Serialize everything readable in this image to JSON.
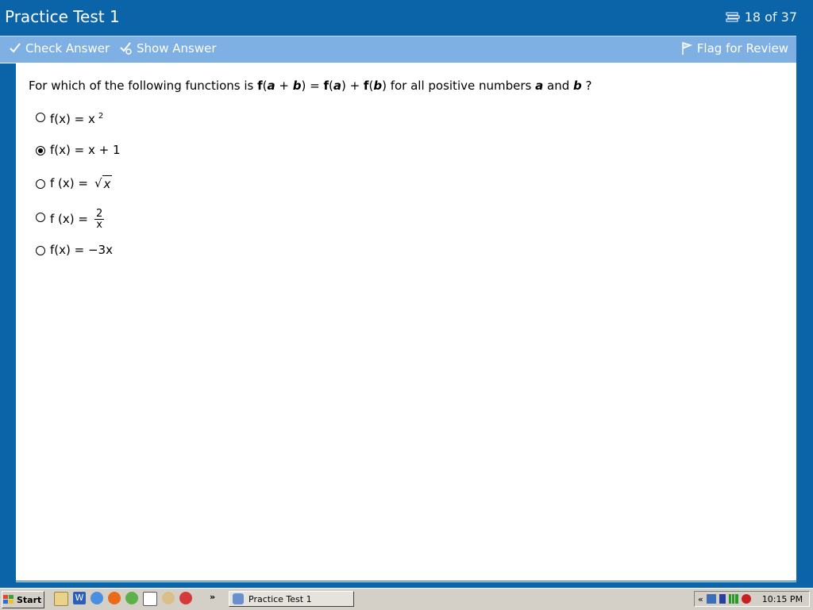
{
  "window": {
    "title": "Practice Test 1"
  },
  "progress": {
    "label": "18 of 37"
  },
  "toolbar": {
    "check_label": "Check Answer",
    "show_label": "Show Answer",
    "flag_label": "Flag for Review"
  },
  "question": {
    "prefix": "For which of the following functions is ",
    "f1": "f",
    "p_open": "(",
    "a": "a",
    "plus": " + ",
    "b": "b",
    "p_close": ")",
    "eq": " = ",
    "suffix": " for all positive numbers ",
    "and": " and ",
    "qmark": " ?"
  },
  "options": [
    {
      "label": "f(x) = x",
      "sup": "2",
      "selected": false
    },
    {
      "label": "f(x) = x + 1",
      "selected": true
    },
    {
      "label": "f (x) =",
      "radicand": "x",
      "selected": false
    },
    {
      "label": "f (x) =",
      "numerator": "2",
      "denominator": "x",
      "selected": false
    },
    {
      "label": "f(x) = −3x",
      "selected": false
    }
  ],
  "taskbar": {
    "start_label": "Start",
    "more_label": "»",
    "task_label": "Practice Test 1",
    "tray_chevron": "«",
    "clock": "10:15 PM"
  },
  "colors": {
    "titlebar": "#0b64a8",
    "toolbar": "#7fb0e4",
    "taskbar": "#d4d0c8"
  }
}
